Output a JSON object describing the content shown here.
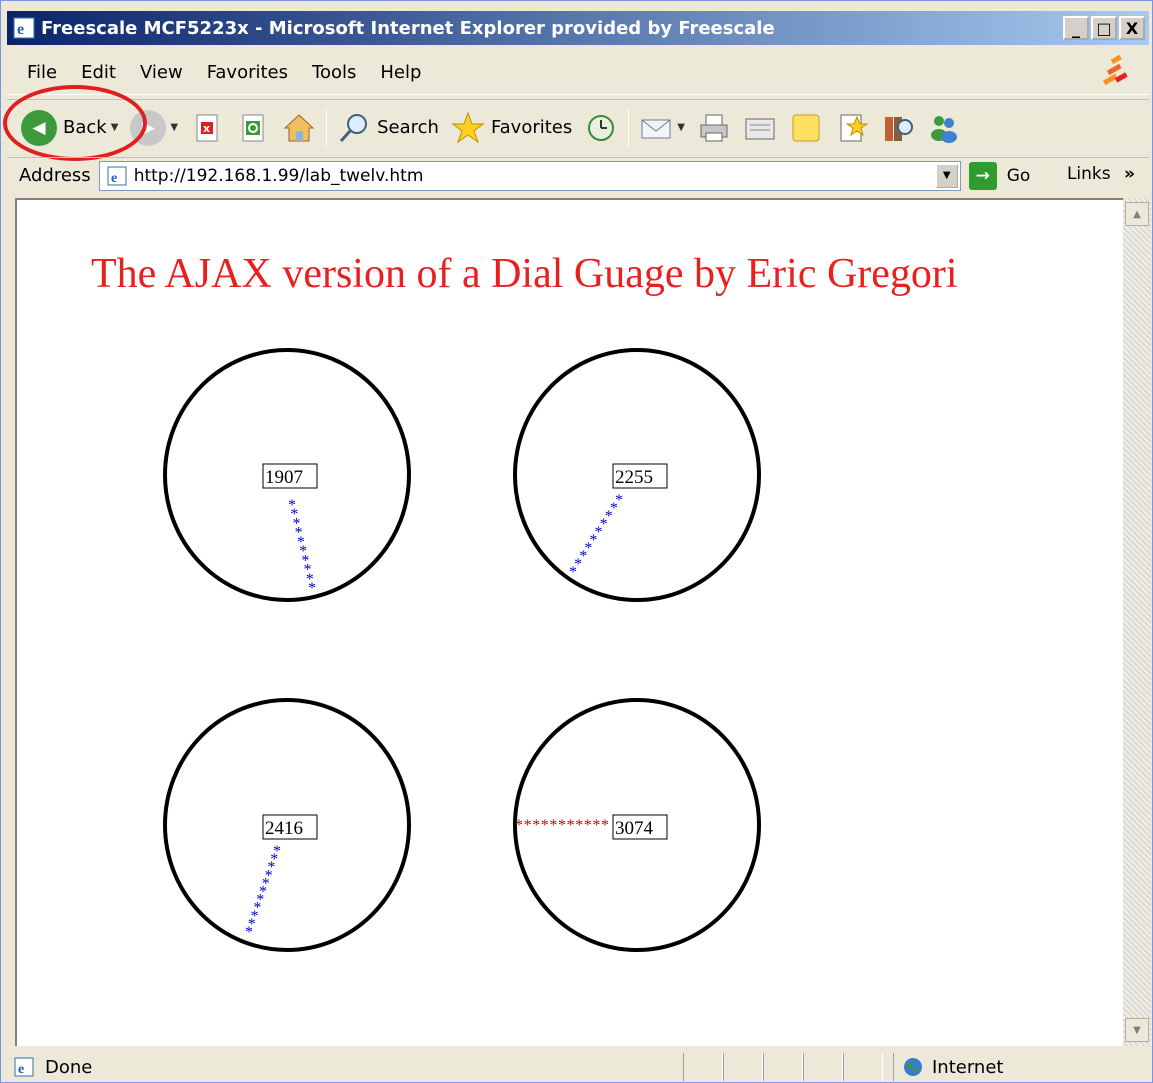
{
  "window": {
    "title": "Freescale MCF5223x - Microsoft Internet Explorer provided by Freescale",
    "minimize": "_",
    "maximize": "□",
    "close": "X"
  },
  "menu": {
    "items": [
      "File",
      "Edit",
      "View",
      "Favorites",
      "Tools",
      "Help"
    ]
  },
  "toolbar": {
    "back_label": "Back",
    "search_label": "Search",
    "favorites_label": "Favorites"
  },
  "address": {
    "label": "Address",
    "url": "http://192.168.1.99/lab_twelv.htm",
    "go_label": "Go",
    "links_label": "Links",
    "links_chevron": "»"
  },
  "page": {
    "title": "The AJAX version of a Dial Guage by Eric Gregori",
    "gauges": [
      {
        "value": "1907",
        "needle_color": "#0000cc"
      },
      {
        "value": "2255",
        "needle_color": "#0000cc"
      },
      {
        "value": "2416",
        "needle_color": "#0000cc"
      },
      {
        "value": "3074",
        "needle_color": "#cc0000"
      }
    ],
    "title_color": "#e82020"
  },
  "status": {
    "text": "Done",
    "zone": "Internet"
  },
  "icons": {
    "app": "ie-icon",
    "logo": "freescale-logo",
    "forward": "forward-icon",
    "stop": "stop-icon",
    "refresh": "refresh-icon",
    "home": "home-icon",
    "search": "search-icon",
    "favorites": "favorites-icon",
    "history": "history-icon",
    "mail": "mail-icon",
    "print": "print-icon",
    "edit": "edit-icon",
    "note": "note-icon",
    "research": "research-icon",
    "messenger": "messenger-icon"
  },
  "annotation_color": "#e02020"
}
